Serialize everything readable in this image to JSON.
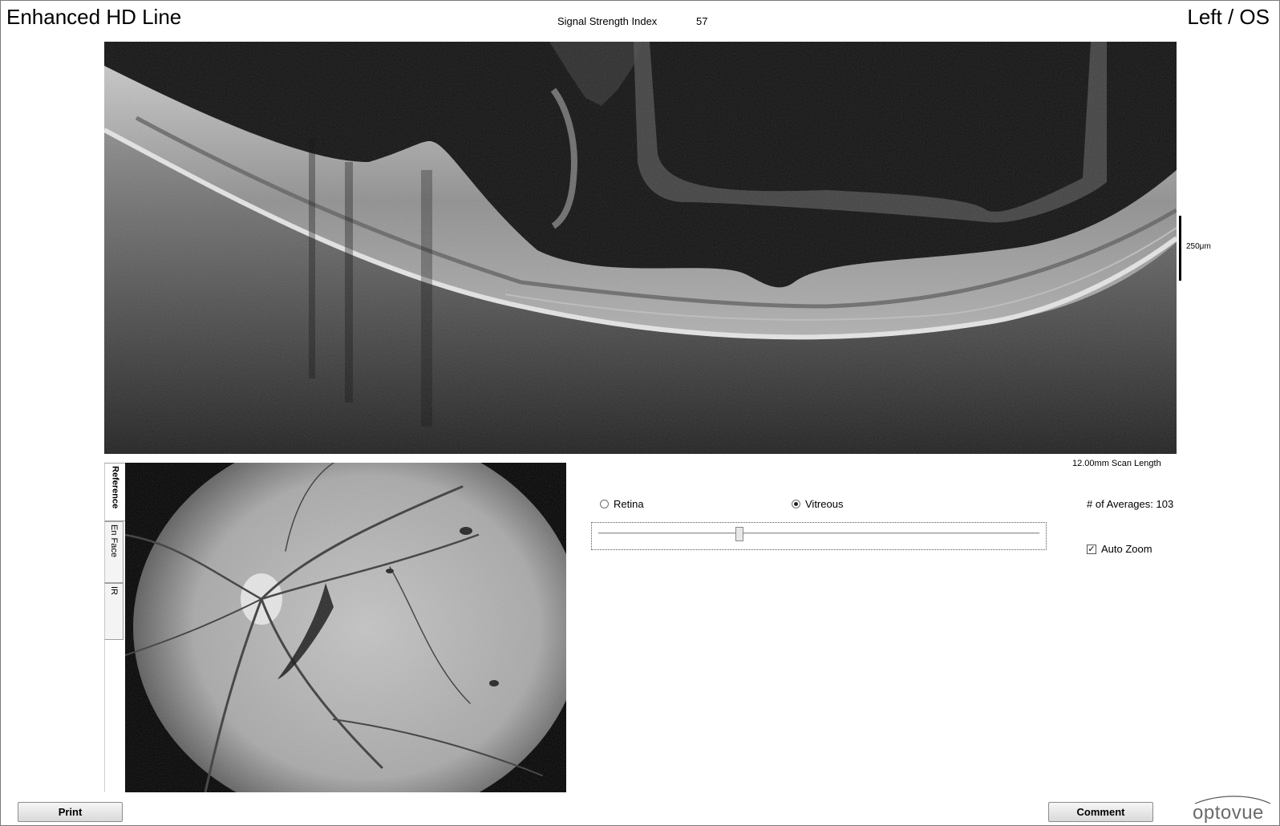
{
  "header": {
    "title": "Enhanced HD Line",
    "eye": "Left / OS",
    "ssi_label": "Signal Strength Index",
    "ssi_value": "57"
  },
  "bscan": {
    "scale_label": "250μm",
    "scan_length": "12.00mm Scan Length"
  },
  "tabs": [
    {
      "label": "Reference",
      "active": true
    },
    {
      "label": "En Face",
      "active": false
    },
    {
      "label": "IR",
      "active": false
    }
  ],
  "controls": {
    "radio_retina": "Retina",
    "radio_vitreous": "Vitreous",
    "selected": "Vitreous",
    "slider_fraction": 0.32,
    "averages": "# of Averages: 103",
    "autozoom_label": "Auto Zoom",
    "autozoom_checked": true
  },
  "buttons": {
    "print": "Print",
    "comment": "Comment"
  },
  "logo": {
    "text": "optovue"
  }
}
